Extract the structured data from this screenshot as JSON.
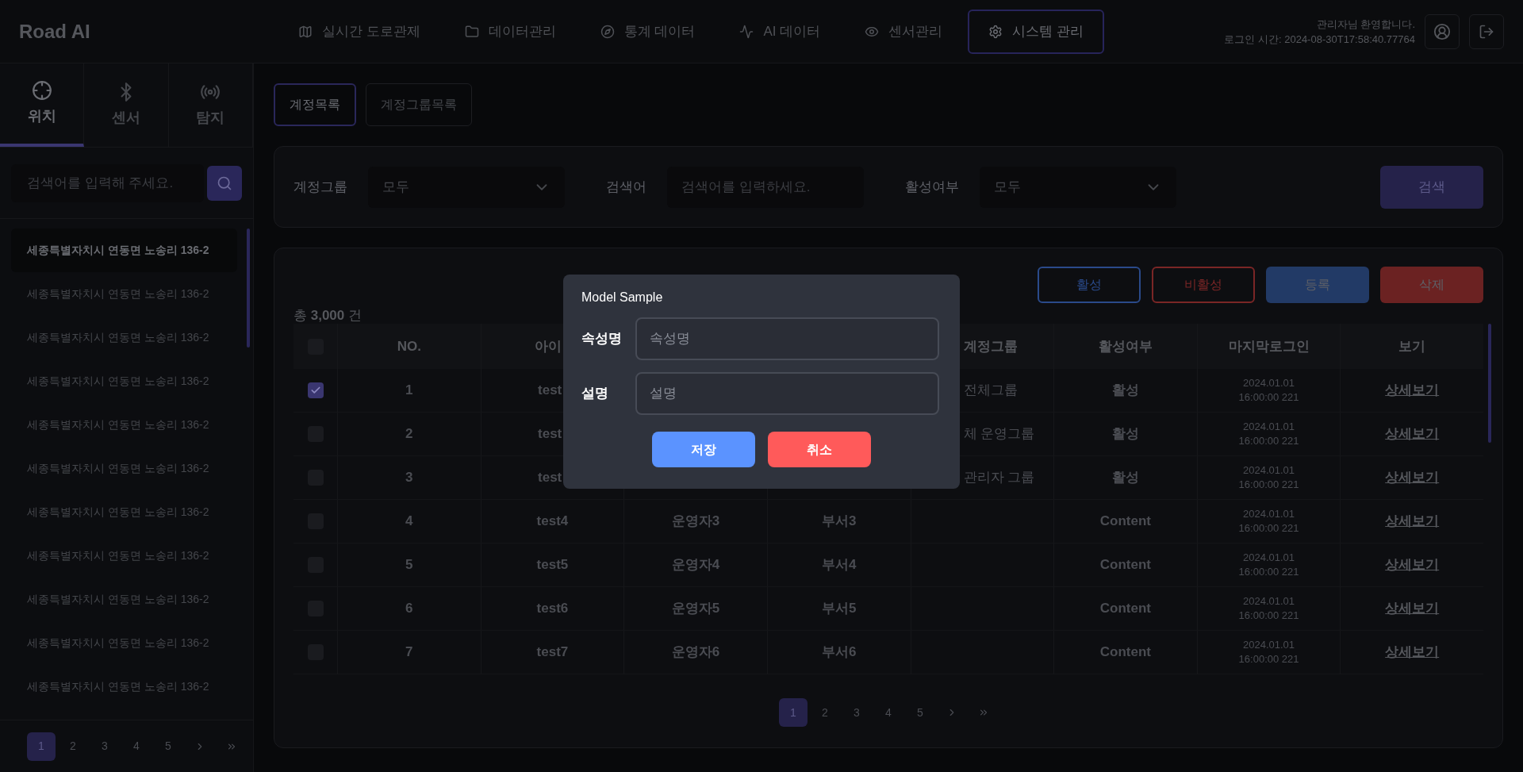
{
  "header": {
    "logo": "Road AI",
    "nav": [
      {
        "label": "실시간 도로관제",
        "selected": false
      },
      {
        "label": "데이터관리",
        "selected": false
      },
      {
        "label": "통계 데이터",
        "selected": false
      },
      {
        "label": "AI 데이터",
        "selected": false
      },
      {
        "label": "센서관리",
        "selected": false
      },
      {
        "label": "시스템 관리",
        "selected": true
      }
    ],
    "greeting": "관리자님 환영합니다.",
    "login_time": "로그인 시간: 2024-08-30T17:58:40.77764"
  },
  "sidebar": {
    "tabs": [
      {
        "label": "위치",
        "selected": true
      },
      {
        "label": "센서",
        "selected": false
      },
      {
        "label": "탐지",
        "selected": false
      }
    ],
    "search": {
      "placeholder": "검색어를 입력해 주세요."
    },
    "items": [
      {
        "label": "세종특별자치시 연동면 노송리 136-2",
        "selected": true
      },
      {
        "label": "세종특별자치시 연동면 노송리 136-2",
        "selected": false
      },
      {
        "label": "세종특별자치시 연동면 노송리 136-2",
        "selected": false
      },
      {
        "label": "세종특별자치시 연동면 노송리 136-2",
        "selected": false
      },
      {
        "label": "세종특별자치시 연동면 노송리 136-2",
        "selected": false
      },
      {
        "label": "세종특별자치시 연동면 노송리 136-2",
        "selected": false
      },
      {
        "label": "세종특별자치시 연동면 노송리 136-2",
        "selected": false
      },
      {
        "label": "세종특별자치시 연동면 노송리 136-2",
        "selected": false
      },
      {
        "label": "세종특별자치시 연동면 노송리 136-2",
        "selected": false
      },
      {
        "label": "세종특별자치시 연동면 노송리 136-2",
        "selected": false
      },
      {
        "label": "세종특별자치시 연동면 노송리 136-2",
        "selected": false
      }
    ],
    "pages": [
      {
        "label": "1",
        "selected": true
      },
      {
        "label": "2",
        "selected": false
      },
      {
        "label": "3",
        "selected": false
      },
      {
        "label": "4",
        "selected": false
      },
      {
        "label": "5",
        "selected": false
      }
    ]
  },
  "main": {
    "tabs": [
      {
        "label": "계정목록",
        "selected": true
      },
      {
        "label": "계정그룹목록",
        "selected": false
      }
    ],
    "filters": [
      {
        "kind": "select",
        "label": "계정그룹",
        "value": "모두"
      },
      {
        "kind": "input",
        "label": "검색어",
        "placeholder": "검색어를 입력하세요."
      },
      {
        "kind": "select",
        "label": "활성여부",
        "value": "모두"
      }
    ],
    "search_button": "검색",
    "total": "총 **3,000** 건",
    "actions": [
      {
        "label": "활성",
        "kind": "outline",
        "color": "#2a4a8a"
      },
      {
        "label": "비활성",
        "kind": "outline",
        "color": "#7a2626"
      },
      {
        "label": "등록",
        "kind": "filled",
        "color": "#223a66"
      },
      {
        "label": "삭제",
        "kind": "filled",
        "color": "#6b2222"
      }
    ],
    "table": {
      "header_checked": false,
      "columns": [
        {
          "label": "NO."
        },
        {
          "label": "아이",
          "partly_hidden": true
        },
        {},
        {},
        {
          "label": "계정그룹",
          "partly_hidden": true
        },
        {
          "label": "활성여부"
        },
        {
          "label": "마지막로그인"
        },
        {
          "label": "보기"
        }
      ],
      "rows": [
        {
          "checked": true,
          "partly_hidden": true,
          "no": "1",
          "id": "test",
          "group": "전체그룹",
          "status": "활성",
          "date": "2024.01.01",
          "time": "16:00:00 221",
          "link": "상세보기"
        },
        {
          "checked": false,
          "partly_hidden": true,
          "no": "2",
          "id": "test",
          "group": "체 운영그룹",
          "status": "활성",
          "date": "2024.01.01",
          "time": "16:00:00 221",
          "link": "상세보기"
        },
        {
          "checked": false,
          "partly_hidden": true,
          "no": "3",
          "id": "test",
          "group": "관리자 그룹",
          "status": "활성",
          "date": "2024.01.01",
          "time": "16:00:00 221",
          "link": "상세보기"
        },
        {
          "checked": false,
          "no": "4",
          "id": "test4",
          "column_4": "운영자3",
          "column_5": "부서3",
          "status": "Content",
          "date": "2024.01.01",
          "time": "16:00:00 221",
          "link": "상세보기"
        },
        {
          "checked": false,
          "no": "5",
          "id": "test5",
          "column_4": "운영자4",
          "column_5": "부서4",
          "status": "Content",
          "date": "2024.01.01",
          "time": "16:00:00 221",
          "link": "상세보기"
        },
        {
          "checked": false,
          "no": "6",
          "id": "test6",
          "column_4": "운영자5",
          "column_5": "부서5",
          "status": "Content",
          "date": "2024.01.01",
          "time": "16:00:00 221",
          "link": "상세보기"
        },
        {
          "checked": false,
          "no": "7",
          "id": "test7",
          "column_4": "운영자6",
          "column_5": "부서6",
          "status": "Content",
          "date": "2024.01.01",
          "time": "16:00:00 221",
          "link": "상세보기"
        }
      ]
    },
    "pages": [
      {
        "label": "1",
        "selected": true
      },
      {
        "label": "2",
        "selected": false
      },
      {
        "label": "3",
        "selected": false
      },
      {
        "label": "4",
        "selected": false
      },
      {
        "label": "5",
        "selected": false
      }
    ]
  },
  "modal": {
    "title": "Model Sample",
    "fields": [
      {
        "label": "속성명",
        "placeholder": "속성명"
      },
      {
        "label": "설명",
        "placeholder": "설명"
      }
    ],
    "buttons": [
      {
        "label": "저장",
        "color": "#5b93ff"
      },
      {
        "label": "취소",
        "color": "#ff5a5a"
      }
    ]
  }
}
